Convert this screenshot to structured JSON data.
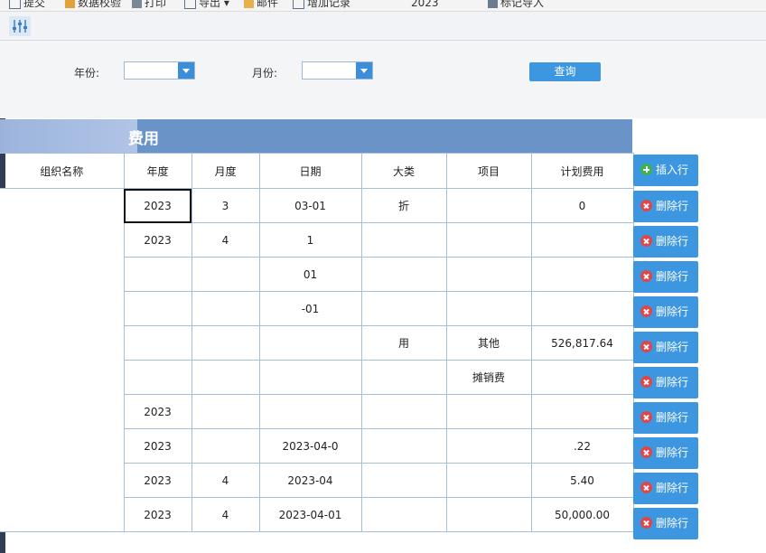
{
  "toolbar": {
    "items": [
      {
        "label": "提交",
        "icon": "submit-icon"
      },
      {
        "label": "数据校验",
        "icon": "pencil-icon"
      },
      {
        "label": "打印",
        "icon": "printer-icon"
      },
      {
        "label": "导出",
        "icon": "export-icon"
      },
      {
        "label": "邮件",
        "icon": "mail-icon"
      },
      {
        "label": "增加记录",
        "icon": "add-record-icon"
      },
      {
        "label": "2023",
        "icon": ""
      },
      {
        "label": "标记导入",
        "icon": "import-icon"
      }
    ]
  },
  "filter": {
    "year_label": "年份:",
    "month_label": "月份:",
    "query_button": "查询"
  },
  "table": {
    "title": "费用",
    "columns": [
      "组织名称",
      "年度",
      "月度",
      "日期",
      "大类",
      "项目",
      "计划费用"
    ],
    "rows": [
      {
        "year": "2023",
        "month": "3",
        "date": "03-01",
        "category": "折",
        "item": "",
        "amount": "0"
      },
      {
        "year": "2023",
        "month": "4",
        "date": "1",
        "category": "",
        "item": "",
        "amount": ""
      },
      {
        "year": "",
        "month": "",
        "date": "01",
        "category": "",
        "item": "",
        "amount": ""
      },
      {
        "year": "",
        "month": "",
        "date": "-01",
        "category": "",
        "item": "",
        "amount": ""
      },
      {
        "year": "",
        "month": "",
        "date": "",
        "category": "用",
        "item": "其他",
        "amount": "526,817.64"
      },
      {
        "year": "",
        "month": "",
        "date": "",
        "category": "",
        "item": "摊销费",
        "amount": ""
      },
      {
        "year": "2023",
        "month": "",
        "date": "",
        "category": "",
        "item": "",
        "amount": ""
      },
      {
        "year": "2023",
        "month": "",
        "date": "2023-04-0",
        "category": "",
        "item": "",
        "amount": ".22"
      },
      {
        "year": "2023",
        "month": "4",
        "date": "2023-04",
        "category": "",
        "item": "",
        "amount": "5.40"
      },
      {
        "year": "2023",
        "month": "4",
        "date": "2023-04-01",
        "category": "",
        "item": "",
        "amount": "50,000.00"
      }
    ]
  },
  "side_buttons": {
    "insert": "插入行",
    "delete": "删除行"
  },
  "colors": {
    "accent": "#3c97e0",
    "title_bar": "#6a93c8",
    "grid_border": "#a7bfdb"
  }
}
